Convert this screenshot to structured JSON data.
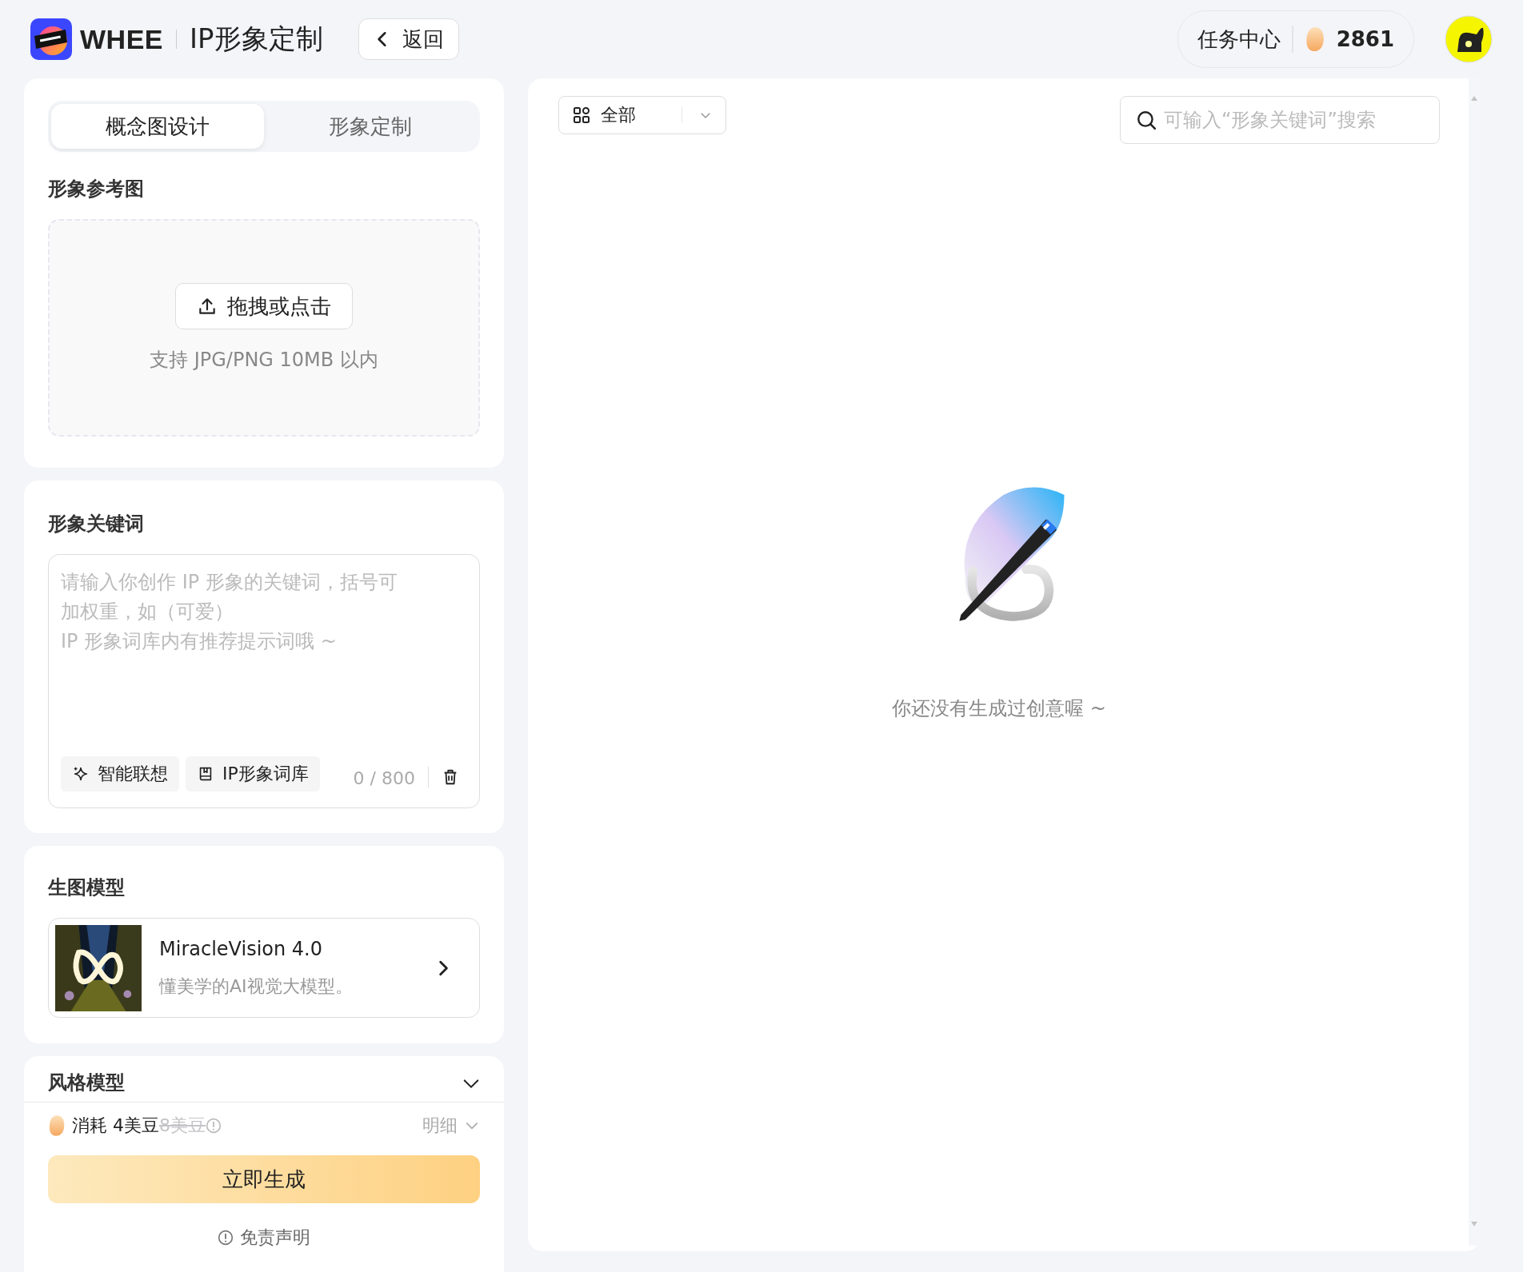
{
  "header": {
    "logo_text": "WHEE",
    "title": "IP形象定制",
    "back_button": "返回",
    "task_center": "任务中心",
    "beans": "2861"
  },
  "tabs": [
    {
      "label": "概念图设计",
      "selected": true
    },
    {
      "label": "形象定制",
      "selected": false
    }
  ],
  "reference": {
    "title": "形象参考图",
    "upload_button": "拖拽或点击",
    "hint": "支持 JPG/PNG 10MB 以内"
  },
  "keywords": {
    "title": "形象关键词",
    "placeholder": "请输入你创作 IP 形象的关键词，括号可加权重，如（可爱）\nIP 形象词库内有推荐提示词哦 ~",
    "tools": [
      {
        "kind": "sparkle",
        "label": "智能联想"
      },
      {
        "kind": "book",
        "label": "IP形象词库"
      }
    ],
    "counter": "0 / 800"
  },
  "model": {
    "title": "生图模型",
    "name": "MiracleVision 4.0",
    "description": "懂美学的AI视觉大模型。"
  },
  "style_model": {
    "title": "风格模型"
  },
  "footer": {
    "cost_label": "消耗 4美豆",
    "original_cost": "8美豆",
    "details": "明细",
    "generate_button": "立即生成",
    "disclaimer": "免责声明"
  },
  "gallery": {
    "filter": "全部",
    "search_placeholder": "可输入“形象关键词”搜索",
    "empty_text": "你还没有生成过创意喔 ~"
  }
}
